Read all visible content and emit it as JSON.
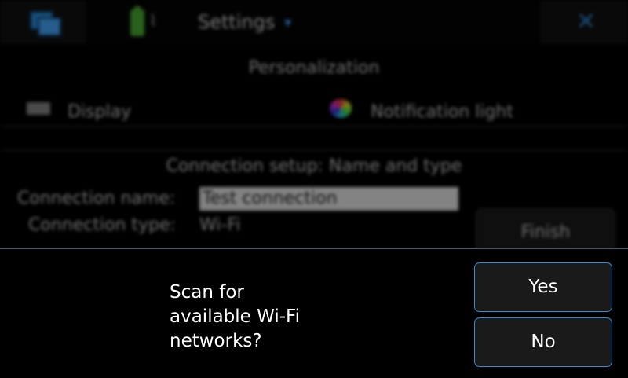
{
  "header": {
    "title": "Settings",
    "icons": [
      "task-switcher-icon",
      "battery-icon",
      "signal-icon",
      "menu-caret-icon",
      "close-icon"
    ]
  },
  "background": {
    "section_personalization": "Personalization",
    "items": [
      {
        "label": "Display",
        "icon": "display-icon"
      },
      {
        "label": "Notification light",
        "icon": "notification-light-icon"
      }
    ],
    "connection_setup_title": "Connection setup: Name and type",
    "connection_name_label": "Connection name:",
    "connection_name_value": "Test connection",
    "connection_type_label": "Connection type:",
    "connection_type_value": "Wi-Fi",
    "finish_label": "Finish"
  },
  "dialog": {
    "message": "Scan for\navailable Wi-Fi\nnetworks?",
    "yes_label": "Yes",
    "no_label": "No",
    "accent_color": "#2f8fd8"
  }
}
